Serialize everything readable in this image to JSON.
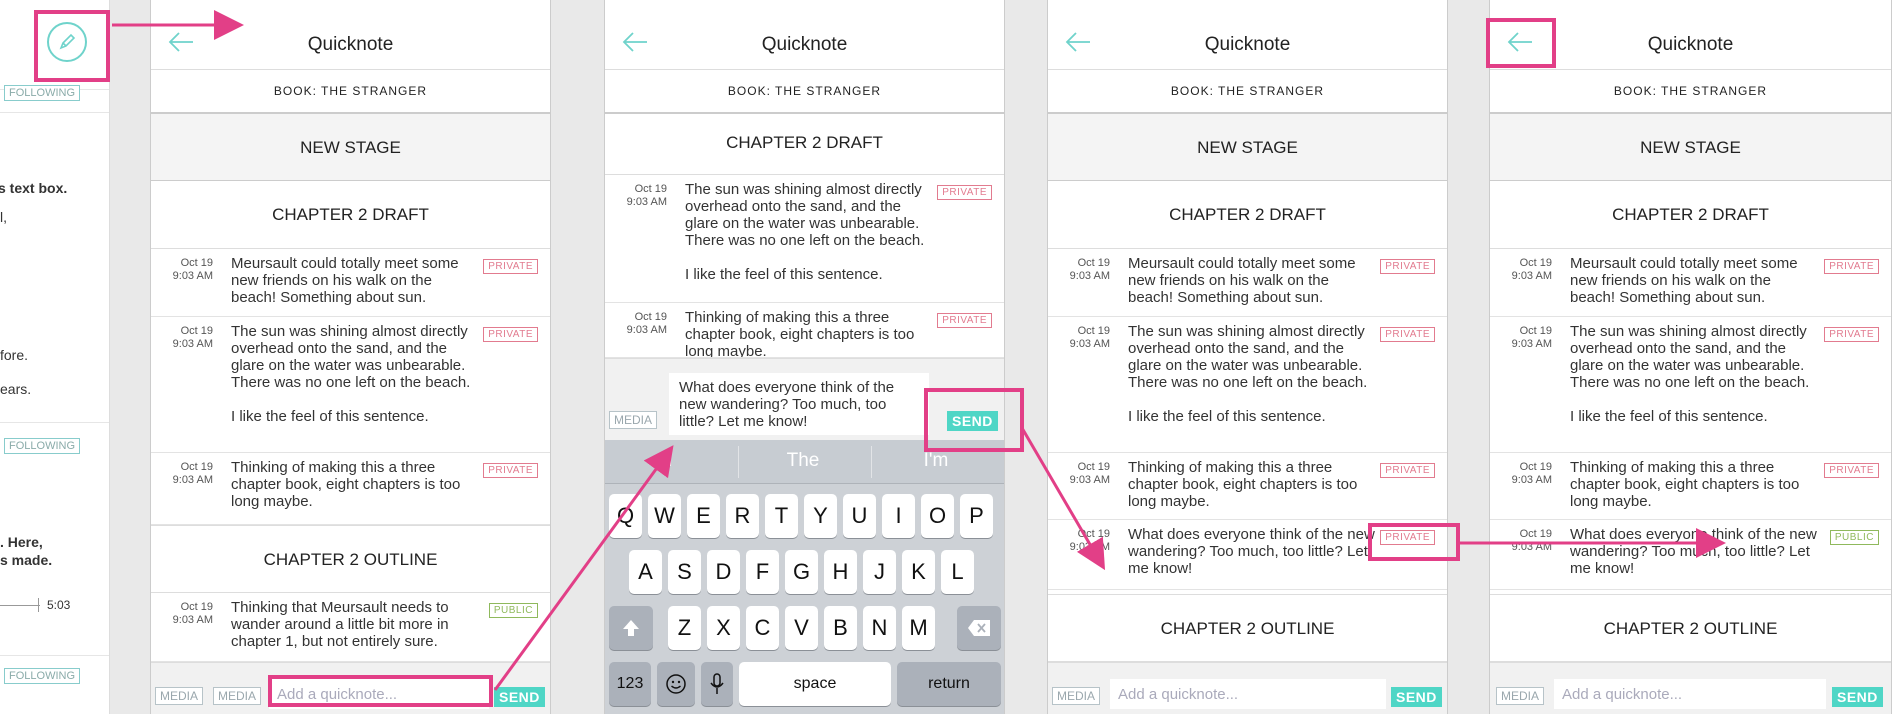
{
  "left_partial": {
    "following_labels": [
      "FOLLOWING",
      "FOLLOWING",
      "FOLLOWING"
    ],
    "text_lines": [
      {
        "text": "s text box.",
        "bold": true
      },
      {
        "text": "l,",
        "bold": false
      },
      {
        "text": "fore.",
        "bold": false
      },
      {
        "text": "ears.",
        "bold": false
      },
      {
        "text": ". Here,",
        "bold": true
      },
      {
        "text": "s made.",
        "bold": true
      }
    ],
    "time": "5:03"
  },
  "screen1": {
    "title": "Quicknote",
    "book": "BOOK: THE STRANGER",
    "stage": "NEW STAGE",
    "chapter_draft": "CHAPTER 2 DRAFT",
    "notes": [
      {
        "date": "Oct 19",
        "time": "9:03 AM",
        "text": "Meursault could totally meet some new friends on his walk on the beach! Something about sun.",
        "tag": "PRIVATE"
      },
      {
        "date": "Oct 19",
        "time": "9:03 AM",
        "text": "The sun was shining almost directly overhead onto the sand, and the glare on the water was unbearable. There was no one left on the beach.\n\nI like the feel of this sentence.",
        "tag": "PRIVATE"
      },
      {
        "date": "Oct 19",
        "time": "9:03 AM",
        "text": "Thinking of making this a three chapter book, eight chapters is too long maybe.",
        "tag": "PRIVATE"
      }
    ],
    "chapter_outline": "CHAPTER 2 OUTLINE",
    "outline_notes": [
      {
        "date": "Oct 19",
        "time": "9:03 AM",
        "text": "Thinking that Meursault needs to wander around a little bit more in chapter 1, but not entirely sure.",
        "tag": "PUBLIC"
      }
    ],
    "compose": {
      "media1": "MEDIA",
      "media2": "MEDIA",
      "placeholder": "Add a quicknote...",
      "send": "SEND"
    }
  },
  "screen2": {
    "title": "Quicknote",
    "book": "BOOK: THE STRANGER",
    "chapter_draft": "CHAPTER 2 DRAFT",
    "notes": [
      {
        "date": "Oct 19",
        "time": "9:03 AM",
        "text": "The sun was shining almost directly overhead onto the sand, and the glare on the water was unbearable. There was no one left on the beach.\n\nI like the feel of this sentence.",
        "tag": "PRIVATE"
      },
      {
        "date": "Oct 19",
        "time": "9:03 AM",
        "text": "Thinking of making this a three chapter book, eight chapters is too long maybe.",
        "tag": "PRIVATE"
      }
    ],
    "compose": {
      "media": "MEDIA",
      "text": "What does everyone think of the new wandering? Too much, too little? Let me know!",
      "send": "SEND"
    },
    "keyboard": {
      "suggestions": [
        "I",
        "The",
        "I'm"
      ],
      "row1": [
        "Q",
        "W",
        "E",
        "R",
        "T",
        "Y",
        "U",
        "I",
        "O",
        "P"
      ],
      "row2": [
        "A",
        "S",
        "D",
        "F",
        "G",
        "H",
        "J",
        "K",
        "L"
      ],
      "row3": [
        "Z",
        "X",
        "C",
        "V",
        "B",
        "N",
        "M"
      ],
      "num": "123",
      "space": "space",
      "return": "return"
    }
  },
  "screen3": {
    "title": "Quicknote",
    "book": "BOOK: THE STRANGER",
    "stage": "NEW STAGE",
    "chapter_draft": "CHAPTER 2 DRAFT",
    "notes": [
      {
        "date": "Oct 19",
        "time": "9:03 AM",
        "text": "Meursault could totally meet some new friends on his walk on the beach! Something about sun.",
        "tag": "PRIVATE"
      },
      {
        "date": "Oct 19",
        "time": "9:03 AM",
        "text": "The sun was shining almost directly overhead onto the sand, and the glare on the water was unbearable. There was no one left on the beach.\n\nI like the feel of this sentence.",
        "tag": "PRIVATE"
      },
      {
        "date": "Oct 19",
        "time": "9:03 AM",
        "text": "Thinking of making this a three chapter book, eight chapters is too long maybe.",
        "tag": "PRIVATE"
      },
      {
        "date": "Oct 19",
        "time": "9:03 AM",
        "text": "What does everyone think of the new wandering? Too much, too little? Let me know!",
        "tag": "PRIVATE"
      }
    ],
    "chapter_outline": "CHAPTER 2 OUTLINE",
    "compose": {
      "media": "MEDIA",
      "placeholder": "Add a quicknote...",
      "send": "SEND"
    }
  },
  "screen4": {
    "title": "Quicknote",
    "book": "BOOK: THE STRANGER",
    "stage": "NEW STAGE",
    "chapter_draft": "CHAPTER 2 DRAFT",
    "notes": [
      {
        "date": "Oct 19",
        "time": "9:03 AM",
        "text": "Meursault could totally meet some new friends on his walk on the beach! Something about sun.",
        "tag": "PRIVATE"
      },
      {
        "date": "Oct 19",
        "time": "9:03 AM",
        "text": "The sun was shining almost directly overhead onto the sand, and the glare on the water was unbearable. There was no one left on the beach.\n\nI like the feel of this sentence.",
        "tag": "PRIVATE"
      },
      {
        "date": "Oct 19",
        "time": "9:03 AM",
        "text": "Thinking of making this a three chapter book, eight chapters is too long maybe.",
        "tag": "PRIVATE"
      },
      {
        "date": "Oct 19",
        "time": "9:03 AM",
        "text": "What does everyone think of the new wandering? Too much, too little? Let me know!",
        "tag": "PUBLIC"
      }
    ],
    "chapter_outline": "CHAPTER 2 OUTLINE",
    "compose": {
      "media": "MEDIA",
      "placeholder": "Add a quicknote...",
      "send": "SEND"
    }
  },
  "colors": {
    "accent": "#4fd6c6",
    "annotation": "#e23f87",
    "private": "#e27b8f",
    "public": "#8fb95c"
  }
}
